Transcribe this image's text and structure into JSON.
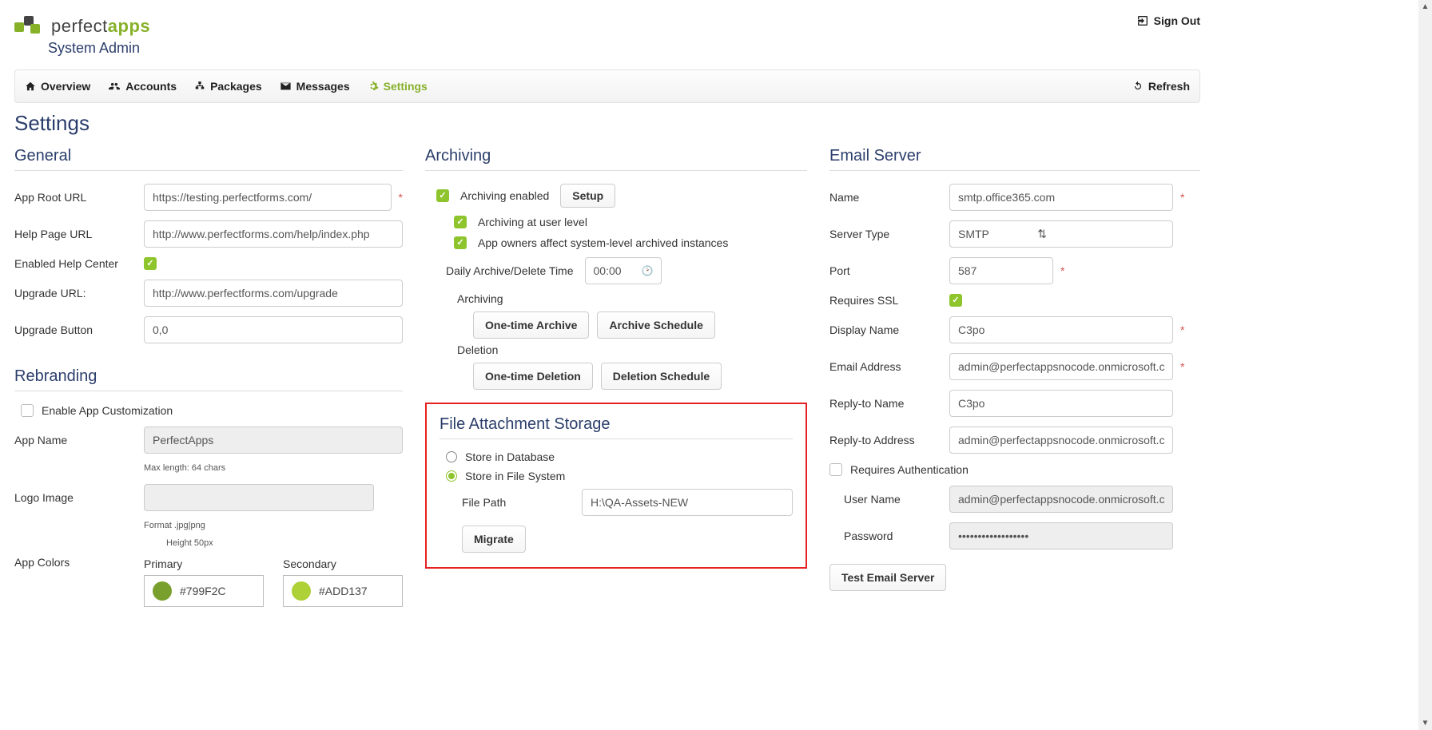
{
  "header": {
    "brand_prefix": "perfect",
    "brand_suffix": "apps",
    "brand_sub": "System Admin",
    "signout": "Sign Out"
  },
  "nav": {
    "items": [
      {
        "label": "Overview"
      },
      {
        "label": "Accounts"
      },
      {
        "label": "Packages"
      },
      {
        "label": "Messages"
      },
      {
        "label": "Settings"
      }
    ],
    "refresh": "Refresh"
  },
  "page_title": "Settings",
  "general": {
    "title": "General",
    "app_root_label": "App Root URL",
    "app_root_value": "https://testing.perfectforms.com/",
    "help_page_label": "Help Page URL",
    "help_page_value": "http://www.perfectforms.com/help/index.php",
    "enabled_help_label": "Enabled Help Center",
    "upgrade_url_label": "Upgrade URL:",
    "upgrade_url_value": "http://www.perfectforms.com/upgrade",
    "upgrade_button_label": "Upgrade Button",
    "upgrade_button_value": "0,0"
  },
  "rebranding": {
    "title": "Rebranding",
    "enable_custom_label": "Enable App Customization",
    "app_name_label": "App Name",
    "app_name_value": "PerfectApps",
    "app_name_note": "Max length: 64 chars",
    "logo_label": "Logo Image",
    "logo_note": "Format .jpg|png",
    "logo_height_note": "Height 50px",
    "colors_label": "App Colors",
    "primary_label": "Primary",
    "primary_value": "#799F2C",
    "secondary_label": "Secondary",
    "secondary_value": "#ADD137"
  },
  "archiving": {
    "title": "Archiving",
    "enabled_label": "Archiving enabled",
    "setup": "Setup",
    "user_level_label": "Archiving at user level",
    "owners_label": "App owners affect system-level archived instances",
    "daily_time_label": "Daily Archive/Delete Time",
    "daily_time_value": "00:00",
    "arch_group": "Archiving",
    "one_time_archive": "One-time Archive",
    "archive_schedule": "Archive Schedule",
    "del_group": "Deletion",
    "one_time_deletion": "One-time Deletion",
    "deletion_schedule": "Deletion Schedule"
  },
  "storage": {
    "title": "File Attachment Storage",
    "opt_db": "Store in Database",
    "opt_fs": "Store in File System",
    "file_path_label": "File Path",
    "file_path_value": "H:\\QA-Assets-NEW",
    "migrate": "Migrate"
  },
  "email": {
    "title": "Email Server",
    "name_label": "Name",
    "name_value": "smtp.office365.com",
    "type_label": "Server Type",
    "type_value": "SMTP",
    "port_label": "Port",
    "port_value": "587",
    "ssl_label": "Requires SSL",
    "display_name_label": "Display Name",
    "display_name_value": "C3po",
    "email_label": "Email Address",
    "email_value": "admin@perfectappsnocode.onmicrosoft.com",
    "reply_name_label": "Reply-to Name",
    "reply_name_value": "C3po",
    "reply_addr_label": "Reply-to Address",
    "reply_addr_value": "admin@perfectappsnocode.onmicrosoft.com",
    "auth_label": "Requires Authentication",
    "user_label": "User Name",
    "user_value": "admin@perfectappsnocode.onmicrosoft.com",
    "pass_label": "Password",
    "pass_value": "••••••••••••••••••",
    "test": "Test Email Server"
  }
}
